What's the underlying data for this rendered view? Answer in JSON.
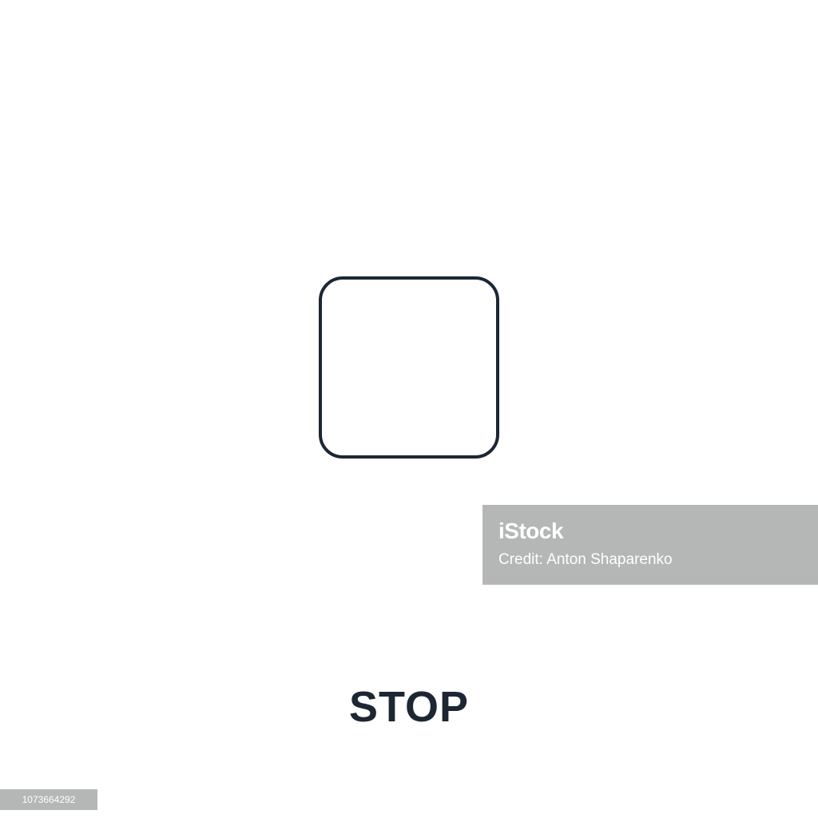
{
  "icon": {
    "name": "stop-icon",
    "stroke_color": "#1c2733"
  },
  "label": {
    "text": "STOP",
    "color": "#1c2733"
  },
  "watermark": {
    "brand": "iStock",
    "credit": "Credit: Anton Shaparenko",
    "background": "#b4b7b6"
  },
  "stock_id": {
    "text": "1073664292"
  }
}
